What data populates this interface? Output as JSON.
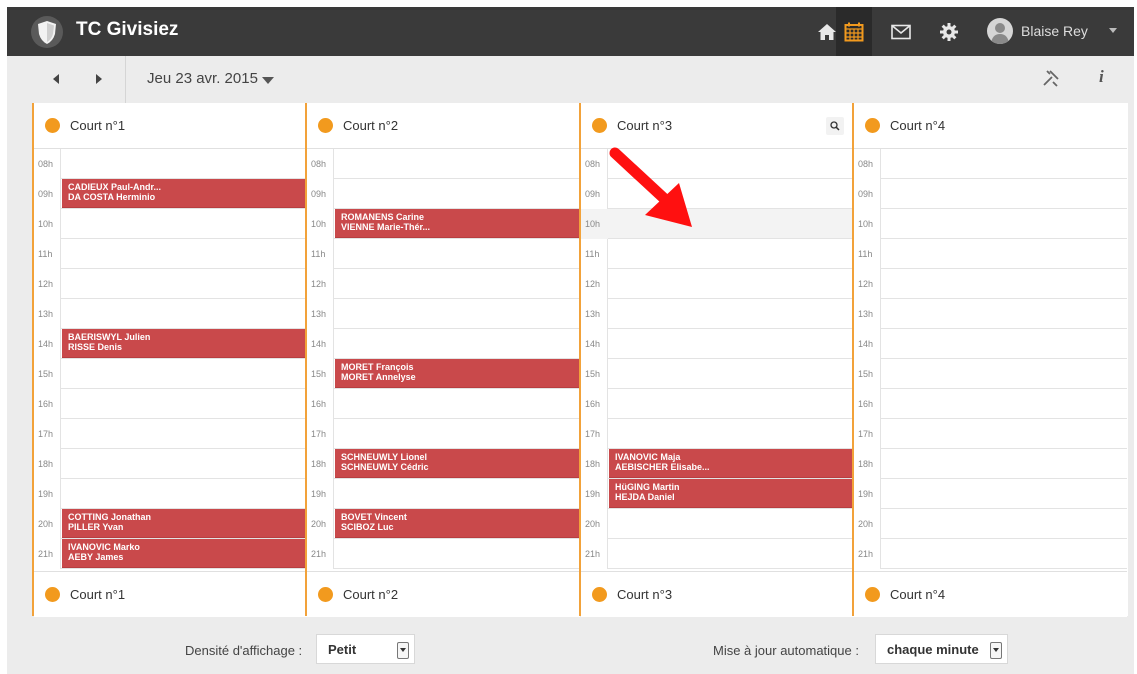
{
  "navbar": {
    "brand": "TC Givisiez",
    "user": "Blaise Rey",
    "icons": [
      "home-icon",
      "calendar-icon",
      "mail-icon",
      "gear-icon",
      "user-icon"
    ],
    "colors": {
      "bar": "#3a3a3a",
      "active": "#f29a1e"
    }
  },
  "toolbar": {
    "date": "Jeu 23 avr. 2015",
    "info_label": "i"
  },
  "hours": [
    "08h",
    "09h",
    "10h",
    "11h",
    "12h",
    "13h",
    "14h",
    "15h",
    "16h",
    "17h",
    "18h",
    "19h",
    "20h",
    "21h"
  ],
  "courts": [
    {
      "name": "Court n°1",
      "bookings": [
        {
          "hour": "09h",
          "names": [
            "CADIEUX Paul-Andr...",
            "DA COSTA Herminio"
          ]
        },
        {
          "hour": "14h",
          "names": [
            "BAERISWYL Julien",
            "RISSE Denis"
          ]
        },
        {
          "hour": "20h",
          "names": [
            "COTTING Jonathan",
            "PILLER Yvan"
          ]
        },
        {
          "hour": "21h",
          "names": [
            "IVANOVIC Marko",
            "AEBY James"
          ]
        }
      ]
    },
    {
      "name": "Court n°2",
      "bookings": [
        {
          "hour": "10h",
          "names": [
            "ROMANENS Carine",
            "VIENNE Marie-Thér..."
          ]
        },
        {
          "hour": "15h",
          "names": [
            "MORET François",
            "MORET Annelyse"
          ]
        },
        {
          "hour": "18h",
          "names": [
            "SCHNEUWLY Lionel",
            "SCHNEUWLY Cédric"
          ]
        },
        {
          "hour": "20h",
          "names": [
            "BOVET Vincent",
            "SCIBOZ Luc"
          ]
        }
      ]
    },
    {
      "name": "Court n°3",
      "highlight_hour": "10h",
      "bookings": [
        {
          "hour": "18h",
          "names": [
            "IVANOVIC Maja",
            "AEBISCHER Elisabe..."
          ]
        },
        {
          "hour": "19h",
          "names": [
            "HüGING Martin",
            "HEJDA Daniel"
          ]
        }
      ]
    },
    {
      "name": "Court n°4",
      "bookings": []
    }
  ],
  "bottom": {
    "density_label": "Densité d'affichage :",
    "density_value": "Petit",
    "refresh_label": "Mise à jour automatique :",
    "refresh_value": "chaque minute"
  }
}
